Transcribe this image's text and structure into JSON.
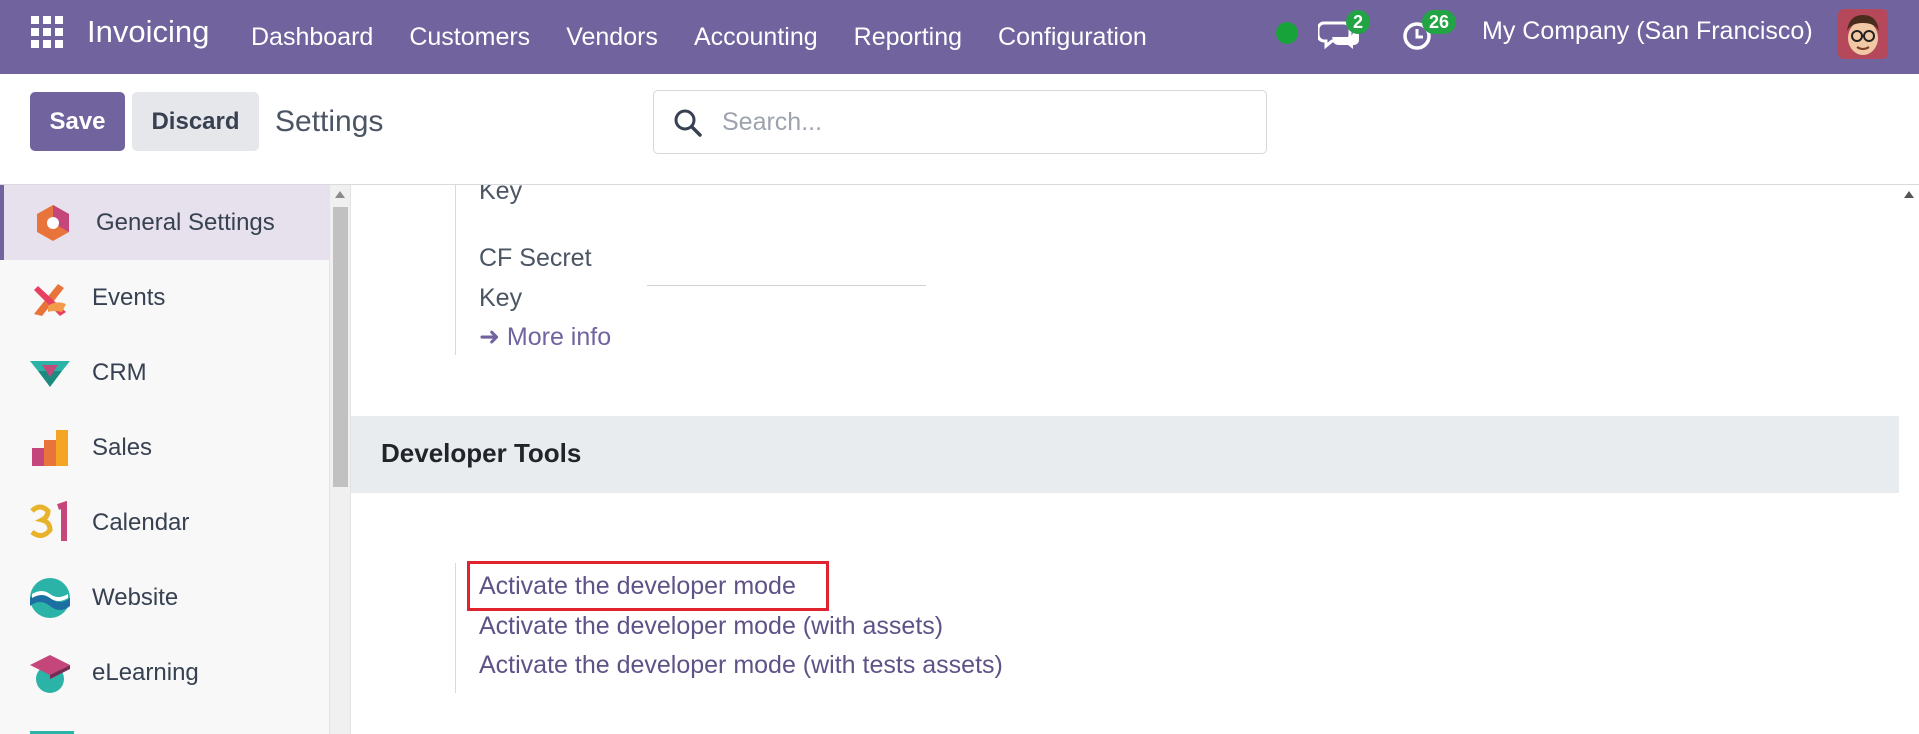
{
  "topbar": {
    "brand": "Invoicing",
    "menu": [
      "Dashboard",
      "Customers",
      "Vendors",
      "Accounting",
      "Reporting",
      "Configuration"
    ],
    "messages_count": "2",
    "activities_count": "26",
    "company": "My Company (San Francisco)",
    "icons": {
      "apps": "grid-icon",
      "status": "online-status-dot",
      "messages": "chat-icon",
      "activities": "clock-icon",
      "avatar": "user-avatar"
    }
  },
  "control": {
    "save_label": "Save",
    "discard_label": "Discard",
    "title": "Settings",
    "search_placeholder": "Search..."
  },
  "sidebar": {
    "items": [
      {
        "label": "General Settings",
        "icon": "general-settings-icon",
        "active": true
      },
      {
        "label": "Events",
        "icon": "events-icon"
      },
      {
        "label": "CRM",
        "icon": "crm-icon"
      },
      {
        "label": "Sales",
        "icon": "sales-icon"
      },
      {
        "label": "Calendar",
        "icon": "calendar-icon"
      },
      {
        "label": "Website",
        "icon": "website-icon"
      },
      {
        "label": "eLearning",
        "icon": "elearning-icon"
      }
    ]
  },
  "main": {
    "key_label_partial": "Key",
    "cf_secret_line1": "CF Secret",
    "cf_secret_line2": "Key",
    "more_info": "More info",
    "section_title": "Developer Tools",
    "dev_links": [
      "Activate the developer mode",
      "Activate the developer mode (with assets)",
      "Activate the developer mode (with tests assets)"
    ]
  },
  "colors": {
    "brand": "#71639e",
    "badge": "#22a344",
    "highlight": "#e0242f"
  }
}
